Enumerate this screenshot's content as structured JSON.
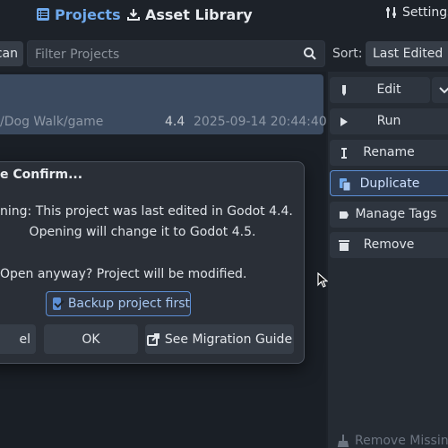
{
  "topbar": {
    "tabs": [
      {
        "label": "Projects",
        "icon": "projects-list-icon"
      },
      {
        "label": "Asset Library",
        "icon": "download-icon"
      }
    ],
    "settings_label": "Settings"
  },
  "toolbar": {
    "scan_label": "can",
    "filter_placeholder": "Filter Projects",
    "sort_label": "Sort:",
    "sort_value": "Last Edited"
  },
  "project": {
    "path": "/Dog Walk/game",
    "version": "4.4",
    "last_edited": "2025-09-14 20:44:40"
  },
  "actions": [
    {
      "label": "Edit",
      "icon": "pencil-icon"
    },
    {
      "label": "Run",
      "icon": "play-icon"
    },
    {
      "label": "Rename",
      "icon": "text-cursor-icon"
    },
    {
      "label": "Duplicate",
      "icon": "duplicate-icon"
    },
    {
      "label": "Manage Tags",
      "icon": "tag-icon"
    },
    {
      "label": "Remove",
      "icon": "trash-icon"
    }
  ],
  "remove_missing_label": "Remove Missing",
  "dialog": {
    "title": "e Confirm...",
    "line1": "ning: This project was last edited in Godot 4.4.",
    "line2": "Opening will change it to Godot 4.5.",
    "line3": "Open anyway? Project will be modified.",
    "backup_label": "Backup project first",
    "backup_checked": true,
    "cancel_label": "el",
    "ok_label": "OK",
    "guide_label": "See Migration Guide"
  },
  "colors": {
    "accent": "#6fa9ec",
    "background": "#1d2229",
    "selected_row": "#3b4a5f"
  }
}
